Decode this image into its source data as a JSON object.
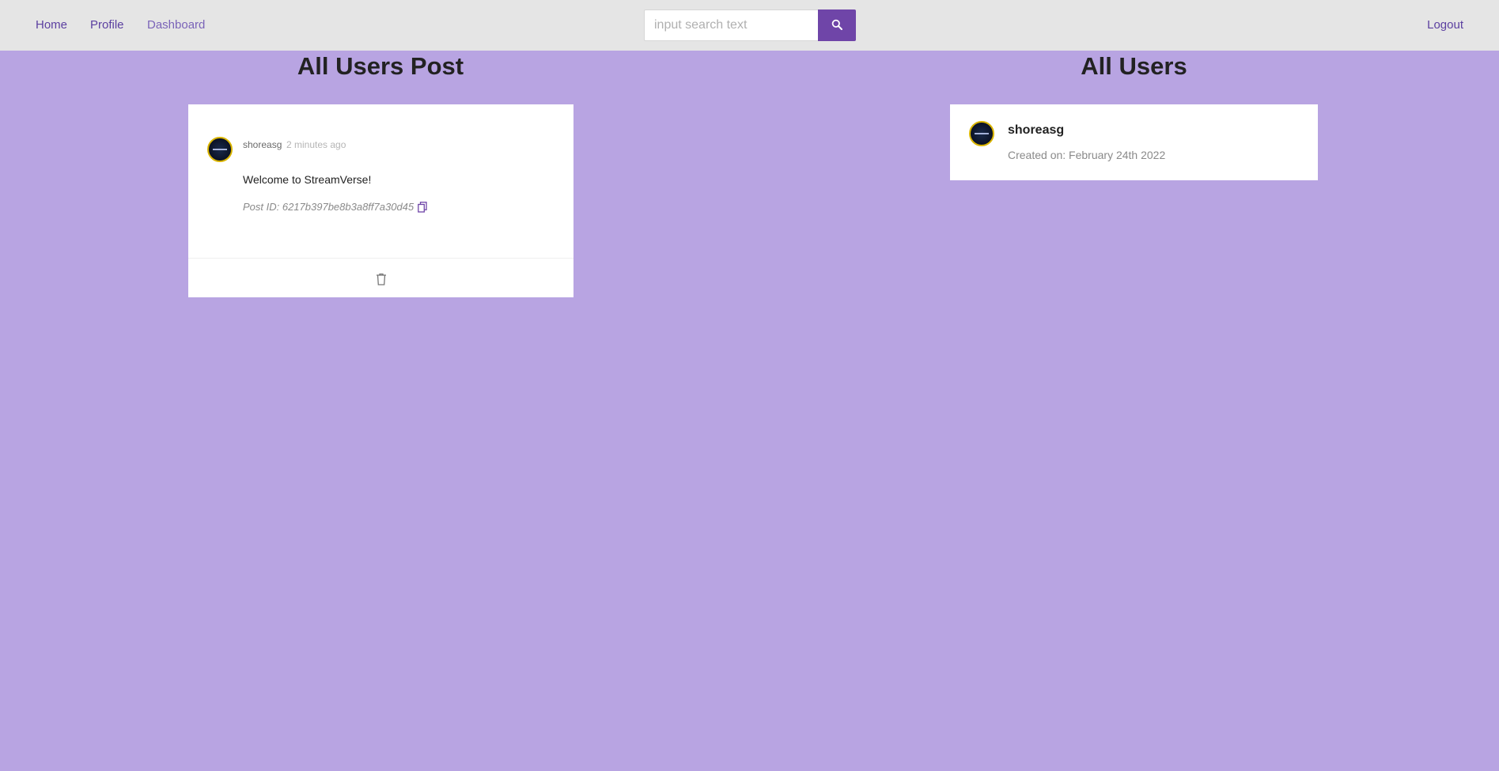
{
  "nav": {
    "home": "Home",
    "profile": "Profile",
    "dashboard": "Dashboard",
    "logout": "Logout"
  },
  "search": {
    "placeholder": "input search text",
    "value": "",
    "button_icon": "search-icon"
  },
  "colors": {
    "background": "#b8a4e2",
    "navbar": "#e5e5e5",
    "accent": "#6f45a8"
  },
  "posts_section": {
    "title": "All Users Post",
    "posts": [
      {
        "author": "shoreasg",
        "time": "2 minutes ago",
        "text": "Welcome to StreamVerse!",
        "post_id_label": "Post ID: 6217b397be8b3a8ff7a30d45",
        "copy_icon": "copy-icon",
        "delete_icon": "trash-icon"
      }
    ]
  },
  "users_section": {
    "title": "All Users",
    "users": [
      {
        "name": "shoreasg",
        "created": "Created on: February 24th 2022"
      }
    ]
  }
}
